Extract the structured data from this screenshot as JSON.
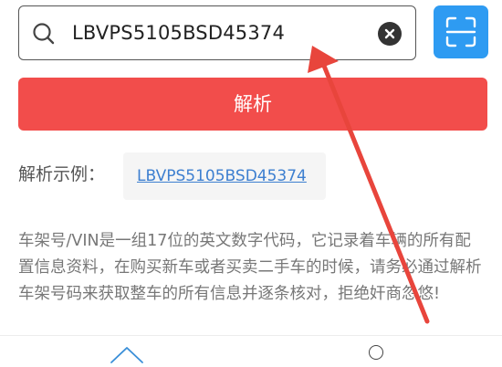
{
  "search": {
    "value": "LBVPS5105BSD45374",
    "icon": "search-icon",
    "clear_icon": "clear-icon"
  },
  "scan": {
    "icon": "scan-icon"
  },
  "parse_button": {
    "label": "解析"
  },
  "example": {
    "label": "解析示例：",
    "vin": "LBVPS5105BSD45374"
  },
  "description": "车架号/VIN是一组17位的英文数字代码，它记录着车辆的所有配置信息资料，在购买新车或者买卖二手车的时候，请务必通过解析车架号码来获取整车的所有信息并逐条核对，拒绝奸商忽悠!",
  "bottom_nav": {
    "items": [
      "home-icon",
      "circle-icon"
    ]
  },
  "colors": {
    "accent_red": "#f24d4b",
    "scan_blue": "#2e9bf2",
    "link_blue": "#3d7fd0",
    "annotation_arrow": "#e8453c"
  }
}
